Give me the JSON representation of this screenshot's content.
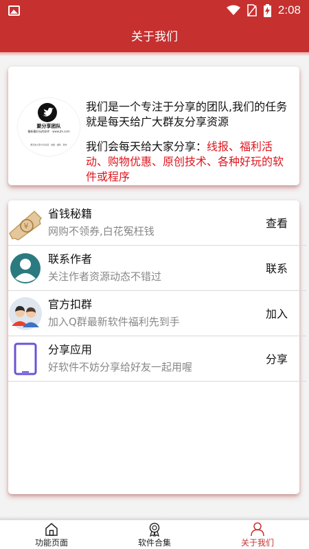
{
  "status_bar": {
    "time": "2:08"
  },
  "header": {
    "title": "关于我们"
  },
  "intro": {
    "logo_name": "聚分享团队",
    "logo_sub": "最新最好玩的软件 · www.jfx.com",
    "logo_tagline": "每天给大家分享资源 · 线报 · 福利 · 软件",
    "line1": "我们是一个专注于分享的团队,我们的任务就是每天给广大群友分享资源",
    "line2_prefix": "我们会每天给大家分享：",
    "line2_highlight": "线报、福利活动、购物优惠、原创技术、各种好玩的软件或程序",
    "highlight_color": "#e0141c"
  },
  "list": {
    "items": [
      {
        "icon": "coupon-icon",
        "title": "省钱秘籍",
        "desc": "网购不领券,白花冤枉钱",
        "action": "查看"
      },
      {
        "icon": "user-avatar-icon",
        "title": "联系作者",
        "desc": "关注作者资源动态不错过",
        "action": "联系"
      },
      {
        "icon": "group-icon",
        "title": "官方扣群",
        "desc": "加入Q群最新软件福利先到手",
        "action": "加入"
      },
      {
        "icon": "phone-icon",
        "title": "分享应用",
        "desc": "好软件不妨分享给好友一起用喔",
        "action": "分享"
      }
    ]
  },
  "tabs": [
    {
      "label": "功能页面",
      "icon": "home-icon",
      "active": false
    },
    {
      "label": "软件合集",
      "icon": "award-icon",
      "active": false
    },
    {
      "label": "关于我们",
      "icon": "person-icon",
      "active": true
    }
  ],
  "colors": {
    "primary": "#c6302f",
    "accent_text": "#e0141c"
  }
}
